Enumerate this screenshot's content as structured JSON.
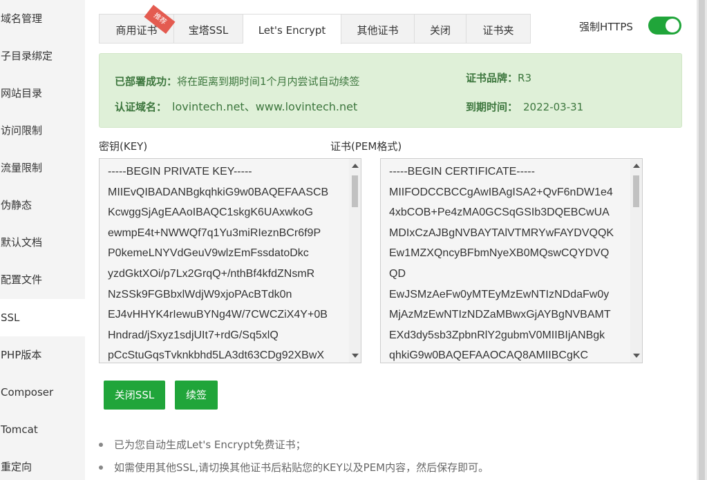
{
  "sidebar": {
    "items": [
      {
        "label": "域名管理"
      },
      {
        "label": "子目录绑定"
      },
      {
        "label": "网站目录"
      },
      {
        "label": "访问限制"
      },
      {
        "label": "流量限制"
      },
      {
        "label": "伪静态"
      },
      {
        "label": "默认文档"
      },
      {
        "label": "配置文件"
      },
      {
        "label": "SSL",
        "active": true
      },
      {
        "label": "PHP版本"
      },
      {
        "label": "Composer"
      },
      {
        "label": "Tomcat"
      },
      {
        "label": "重定向"
      }
    ]
  },
  "tabs": {
    "items": [
      {
        "label": "商用证书",
        "ribbon": "推荐"
      },
      {
        "label": "宝塔SSL"
      },
      {
        "label": "Let's Encrypt",
        "active": true
      },
      {
        "label": "其他证书"
      },
      {
        "label": "关闭"
      },
      {
        "label": "证书夹"
      }
    ]
  },
  "https": {
    "label": "强制HTTPS",
    "enabled": true
  },
  "info": {
    "deploy_key": "已部署成功：",
    "deploy_value": "将在距离到期时间1个月内尝试自动续签",
    "domain_key": "认证域名：",
    "domain_value": "lovintech.net、www.lovintech.net",
    "brand_key": "证书品牌：",
    "brand_value": "R3",
    "expire_key": "到期时间：",
    "expire_value": "2022-03-31"
  },
  "key_box": {
    "label": "密钥(KEY)",
    "lines": [
      "-----BEGIN PRIVATE KEY-----",
      "MIIEvQIBADANBgkqhkiG9w0BAQEFAASCB",
      "KcwggSjAgEAAoIBAQC1skgK6UAxwkoG",
      "ewmpE4t+NWWQf7q1Yu3miRIeznBCr6f9P",
      "P0kemeLNYVdGeuV9wlzEmFssdatoDkc",
      "yzdGktXOi/p7Lx2GrqQ+/nthBf4kfdZNsmR",
      "NzSSk9FGBbxlWdjW9xjoPAcBTdk0n",
      "EJ4vHHYK4rIewuBYNg4W/7CWCZiX4Y+0B",
      "Hndrad/jSxyz1sdjUIt7+rdG/Sq5xlQ",
      "pCcStuGqsTvknkbhd5LA3dt63CDg92XBwX"
    ]
  },
  "cert_box": {
    "label": "证书(PEM格式)",
    "lines": [
      "-----BEGIN CERTIFICATE-----",
      "MIIFODCCBCCgAwIBAgISA2+QvF6nDW1e4",
      "4xbCOB+Pe4zMA0GCSqGSIb3DQEBCwUA",
      "MDIxCzAJBgNVBAYTAlVTMRYwFAYDVQQK",
      "Ew1MZXQncyBFbmNyeXB0MQswCQYDVQ",
      "QD",
      "EwJSMzAeFw0yMTEyMzEwNTIzNDdaFw0y",
      "MjAzMzEwNTIzNDZaMBwxGjAYBgNVBAMT",
      "EXd3dy5sb3ZpbnRlY2gubmV0MIIBIjANBgk",
      "qhkiG9w0BAQEFAAOCAQ8AMIIBCgKC"
    ]
  },
  "buttons": {
    "close_ssl": "关闭SSL",
    "renew": "续签"
  },
  "notes": [
    "已为您自动生成Let's Encrypt免费证书；",
    "如需使用其他SSL,请切换其他证书后粘贴您的KEY以及PEM内容，然后保存即可。"
  ],
  "colors": {
    "accent": "#20a53a",
    "info_bg": "#dff0d8",
    "info_text": "#3c763d",
    "ribbon": "#e45b50"
  }
}
